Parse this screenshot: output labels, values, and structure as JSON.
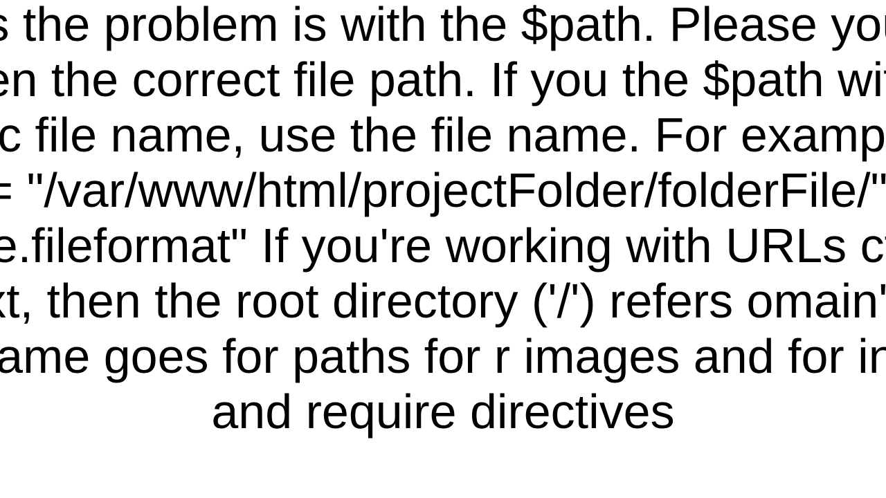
{
  "document": {
    "body_text": "Seems the problem is with the $path. Please you have given the correct file path. If you the $path with a dynamic file name, use the file name. For example, $var = \"/var/www/html/projectFolder/folderFile/\". ame.fileformat\" If you're working with URLs ction context, then the root directory ('/') refers omain's root. The same goes for paths for r images and for include and require directives"
  }
}
